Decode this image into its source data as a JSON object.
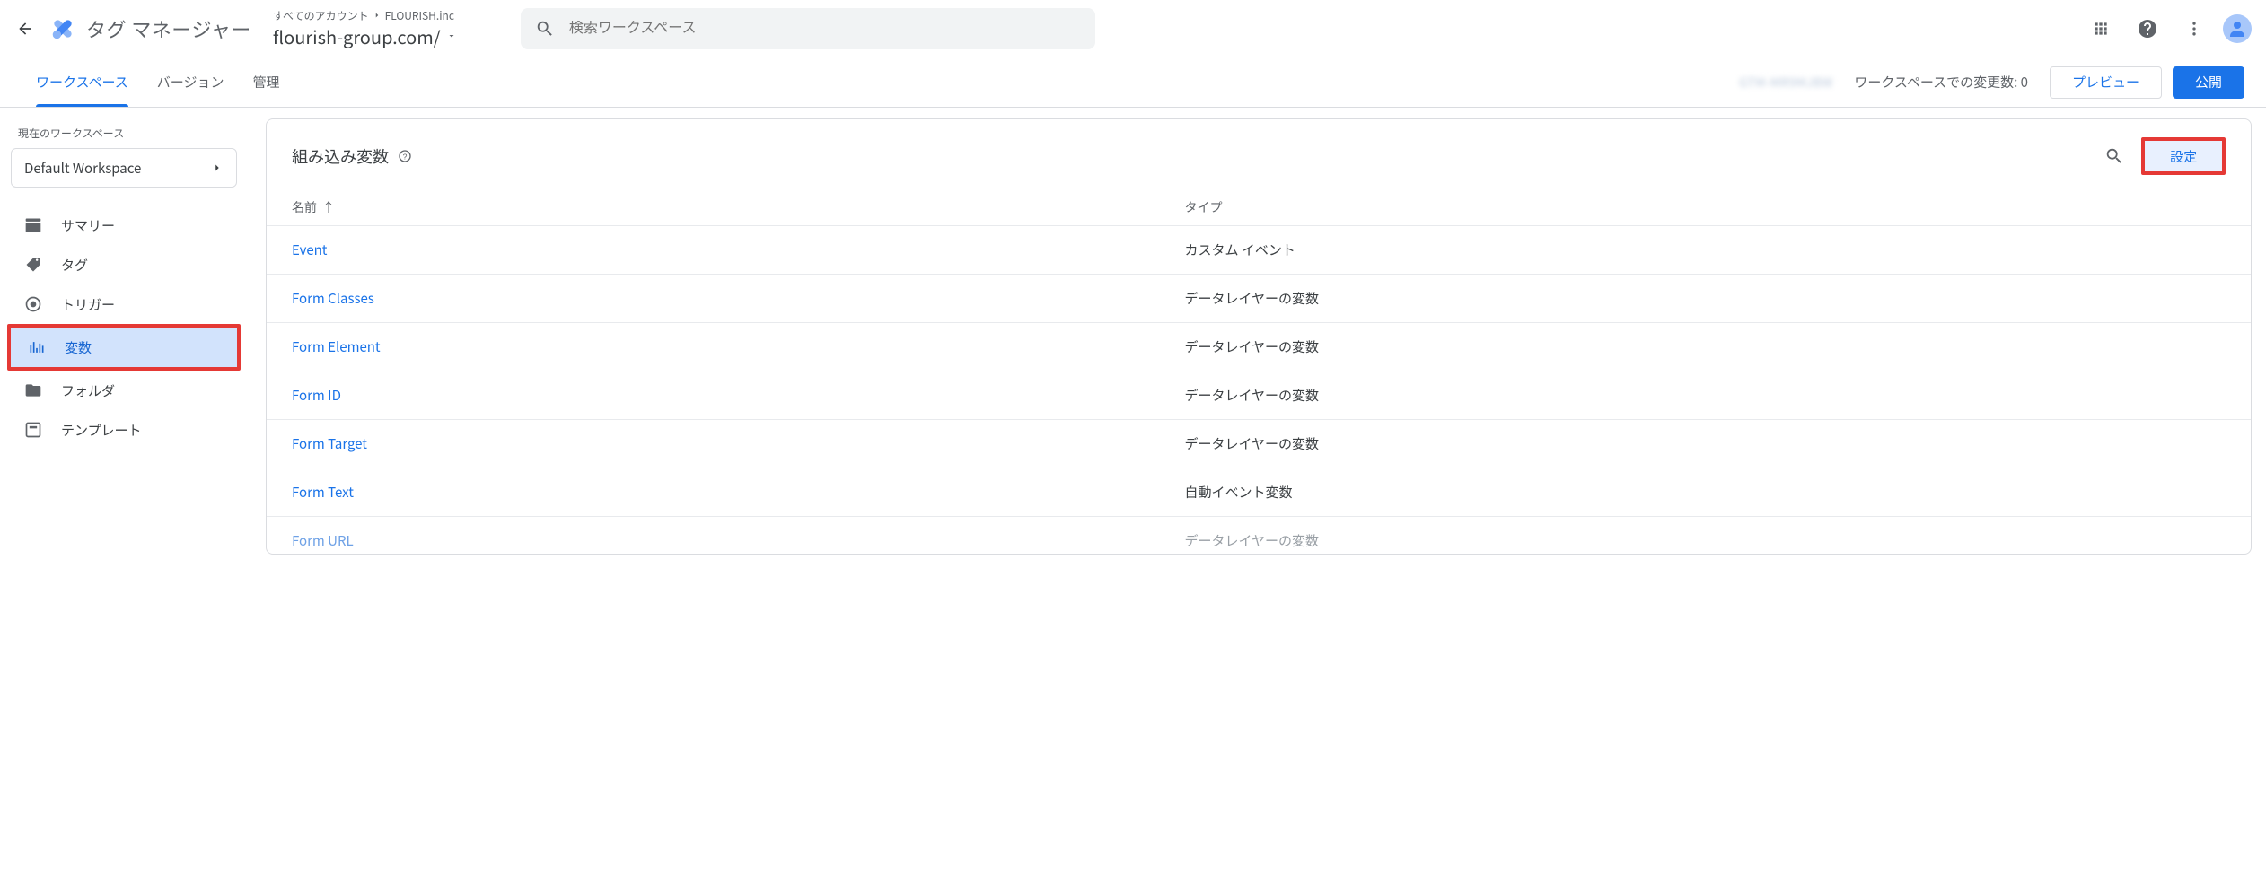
{
  "header": {
    "product_name": "タグ マネージャー",
    "breadcrumb_accounts": "すべてのアカウント",
    "breadcrumb_account": "FLOURISH.inc",
    "container_name": "flourish-group.com/",
    "search_placeholder": "検索ワークスペース"
  },
  "tabs": {
    "workspace": "ワークスペース",
    "versions": "バージョン",
    "admin": "管理",
    "gtm_id": "GTM-MR9MJBW",
    "changes_label": "ワークスペースでの変更数: 0",
    "preview": "プレビュー",
    "publish": "公開"
  },
  "sidebar": {
    "ws_label": "現在のワークスペース",
    "ws_name": "Default Workspace",
    "items": [
      {
        "label": "サマリー"
      },
      {
        "label": "タグ"
      },
      {
        "label": "トリガー"
      },
      {
        "label": "変数"
      },
      {
        "label": "フォルダ"
      },
      {
        "label": "テンプレート"
      }
    ]
  },
  "panel": {
    "title": "組み込み変数",
    "configure": "設定",
    "col_name": "名前",
    "col_type": "タイプ",
    "rows": [
      {
        "name": "Event",
        "type": "カスタム イベント"
      },
      {
        "name": "Form Classes",
        "type": "データレイヤーの変数"
      },
      {
        "name": "Form Element",
        "type": "データレイヤーの変数"
      },
      {
        "name": "Form ID",
        "type": "データレイヤーの変数"
      },
      {
        "name": "Form Target",
        "type": "データレイヤーの変数"
      },
      {
        "name": "Form Text",
        "type": "自動イベント変数"
      },
      {
        "name": "Form URL",
        "type": "データレイヤーの変数"
      }
    ]
  }
}
